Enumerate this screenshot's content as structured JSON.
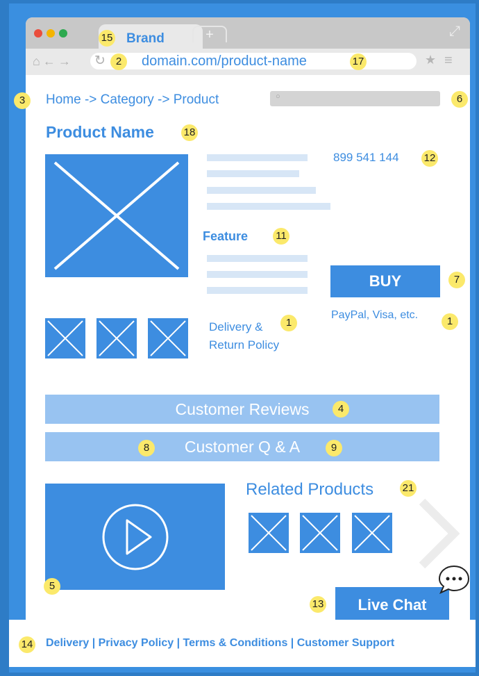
{
  "browser": {
    "tab_label": "Brand",
    "new_tab": "+",
    "url": "domain.com/product-name"
  },
  "page": {
    "breadcrumb": "Home -> Category -> Product",
    "product_name": "Product Name",
    "price_phone": "899 541 144",
    "feature_label": "Feature",
    "buy_label": "BUY",
    "payment_text": "PayPal, Visa, etc.",
    "delivery_line1": "Delivery &",
    "delivery_line2": "Return Policy",
    "reviews_label": "Customer Reviews",
    "qa_label": "Customer Q & A",
    "related_label": "Related Products",
    "live_chat_label": "Live Chat",
    "footer_links": "Delivery | Privacy Policy | Terms & Conditions | Customer Support"
  },
  "badges": {
    "tab": "15",
    "reload": "2",
    "url": "17",
    "breadcrumb": "3",
    "search": "6",
    "product_name": "18",
    "price": "12",
    "feature": "11",
    "buy": "7",
    "delivery": "1",
    "payment": "1",
    "reviews": "4",
    "qa_left": "8",
    "qa_right": "9",
    "related": "21",
    "video": "5",
    "live_chat": "13",
    "footer": "14"
  },
  "colors": {
    "accent": "#3d8de0",
    "light_bar": "#98c3f1",
    "badge": "#fbe96b",
    "background": "#2e7cc6"
  },
  "icons": [
    "home-icon",
    "back-arrow-icon",
    "forward-arrow-icon",
    "reload-icon",
    "star-icon",
    "menu-icon",
    "search-icon",
    "play-icon",
    "chevron-right-icon",
    "chat-bubble-icon",
    "expand-icon"
  ]
}
